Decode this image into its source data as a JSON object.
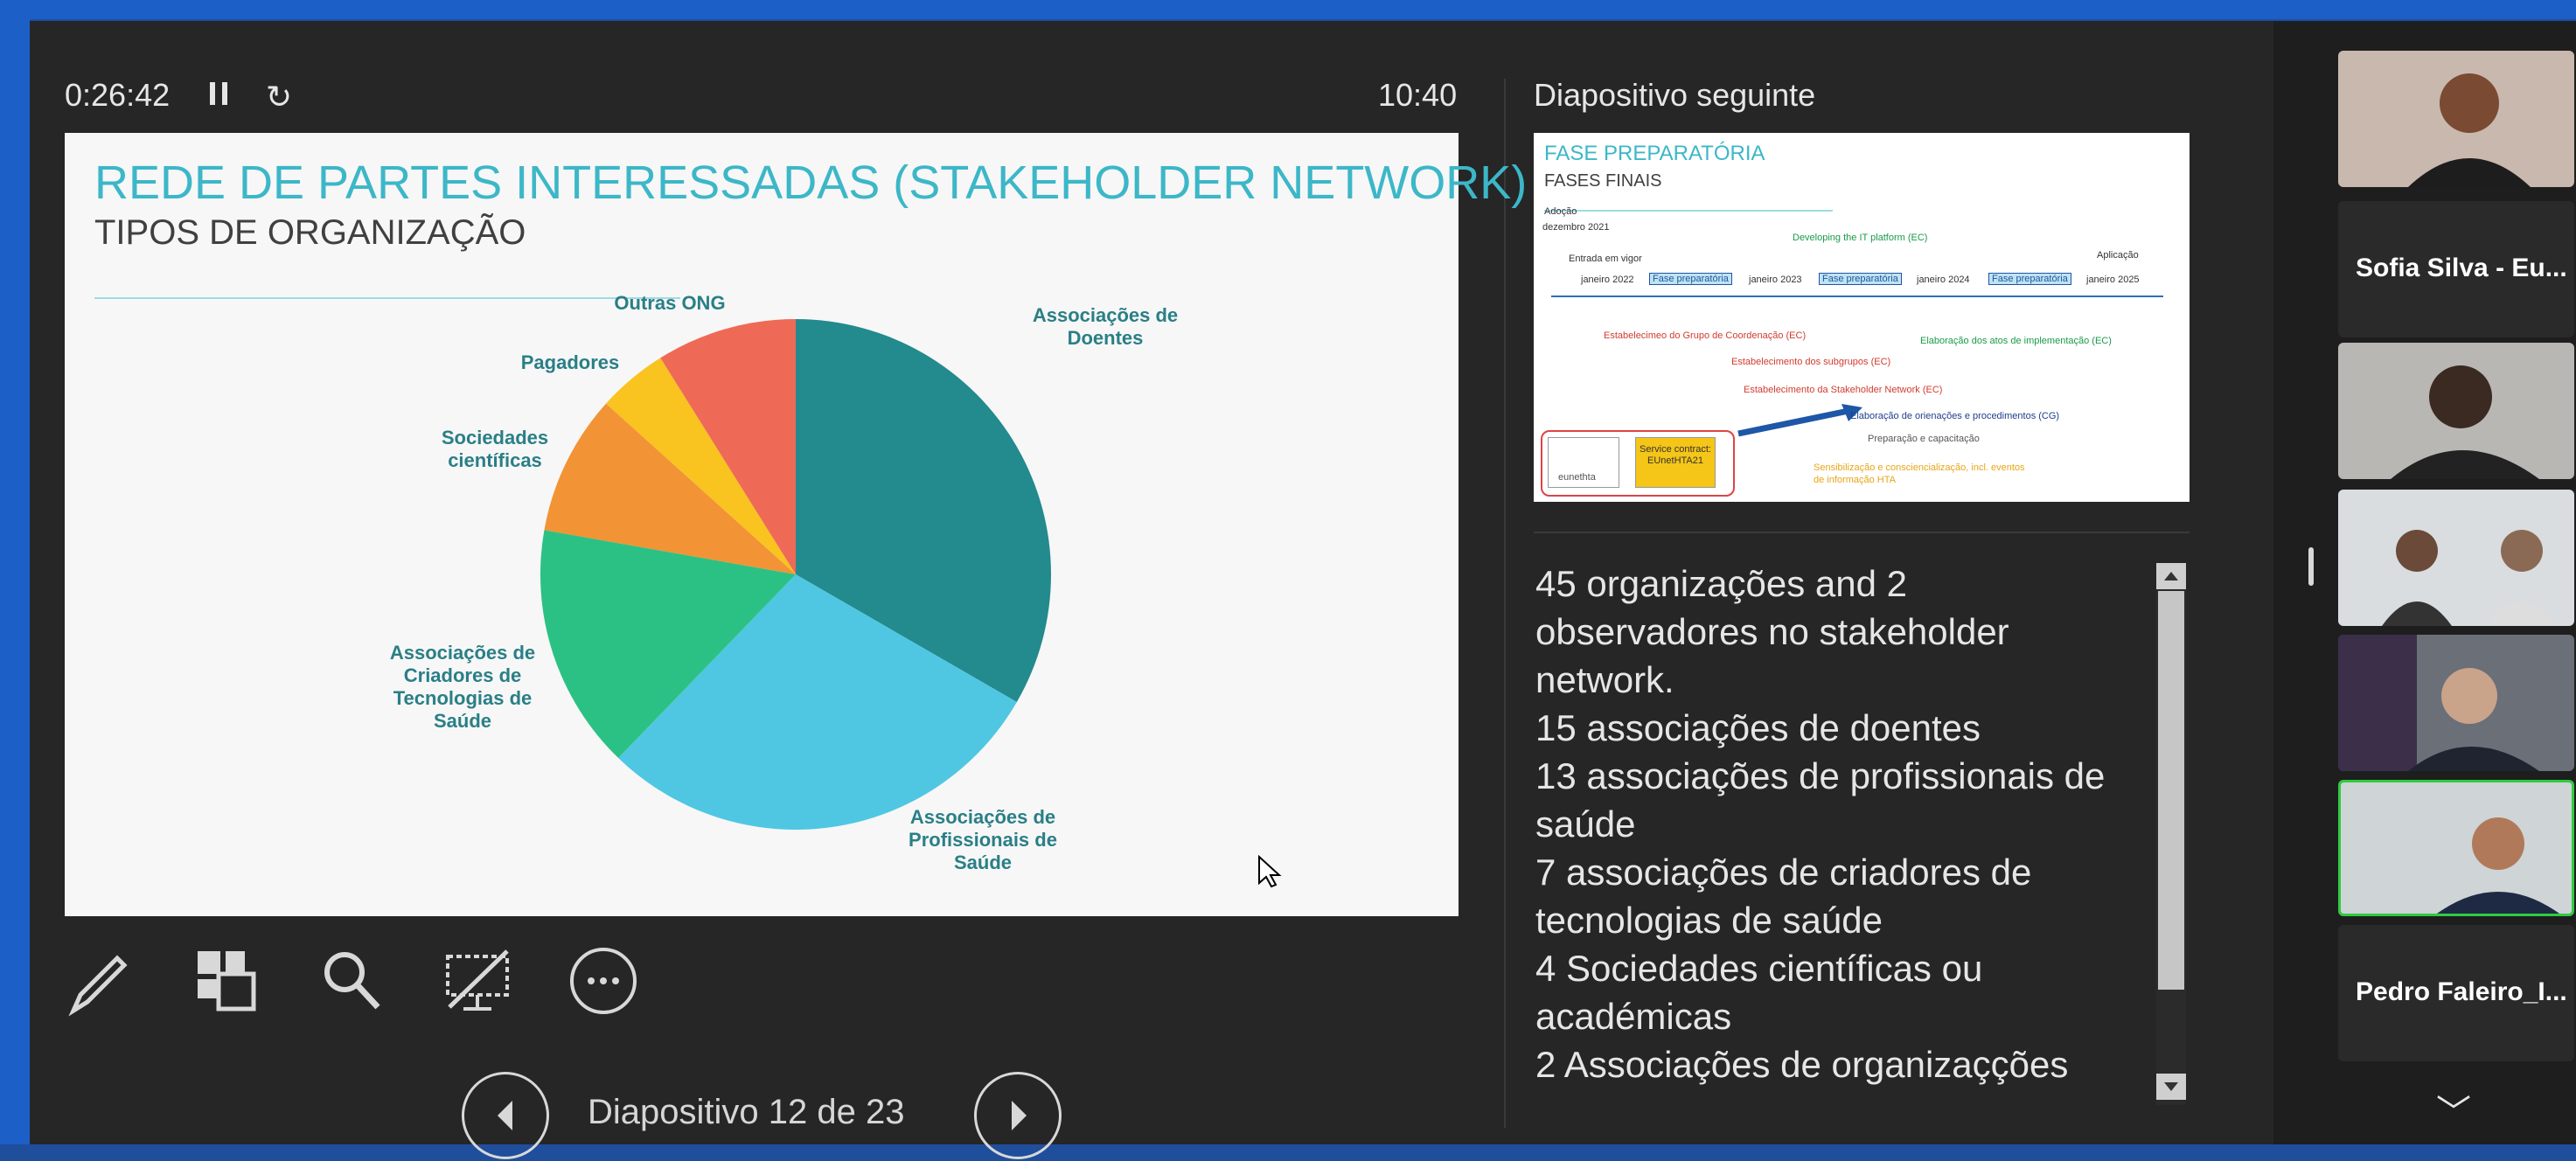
{
  "presenter": {
    "timer": "0:26:42",
    "clock": "10:40",
    "next_slide_title": "Diapositivo seguinte",
    "slide_counter": "Diapositivo 12 de 23"
  },
  "slide": {
    "title": "REDE DE PARTES INTERESSADAS (STAKEHOLDER NETWORK)",
    "subtitle": "TIPOS DE ORGANIZAÇÃO"
  },
  "chart_data": {
    "type": "pie",
    "title": "",
    "categories": [
      "Associações de Doentes",
      "Associações de Profissionais de Saúde",
      "Associações de Criadores de Tecnologias de Saúde",
      "Sociedades científicas",
      "Pagadores",
      "Outras ONG"
    ],
    "values": [
      15,
      13,
      7,
      4,
      2,
      4
    ],
    "colors": [
      "#238a8e",
      "#4fc7e2",
      "#2cc184",
      "#f29335",
      "#f9c320",
      "#ef6a56"
    ],
    "labels": [
      [
        "Associações de",
        "Doentes"
      ],
      [
        "Associações de",
        "Profissionais de",
        "Saúde"
      ],
      [
        "Associações de",
        "Criadores de",
        "Tecnologias de",
        "Saúde"
      ],
      [
        "Sociedades",
        "científicas"
      ],
      [
        "Pagadores"
      ],
      [
        "Outras ONG"
      ]
    ]
  },
  "next_slide": {
    "title": "FASE PREPARATÓRIA",
    "subtitle": "FASES FINAIS",
    "texts": [
      "Adoção",
      "dezembro 2021",
      "Entrada em vigor",
      "janeiro 2022",
      "Fase preparatória",
      "janeiro 2023",
      "Fase preparatória",
      "janeiro 2024",
      "Fase preparatória",
      "janeiro 2025",
      "Aplicação",
      "Developing the IT platform (EC)",
      "Estabelecimeo do Grupo de Coordenação (EC)",
      "Estabelecimento dos subgrupos (EC)",
      "Estabelecimento da Stakeholder Network (EC)",
      "Elaboração dos atos de implementação (EC)",
      "Elaboração de orienações e procedimentos (CG)",
      "Preparação e capacitação",
      "Sensibilização e consciencialização, incl. eventos de informação HTA",
      "eunethta",
      "Service contract: EUnetHTA21"
    ]
  },
  "notes": {
    "lines": [
      "45 organizações and 2",
      "observadores no stakeholder",
      "network.",
      "15 associações de doentes",
      "13 associações de profissionais de",
      "saúde",
      "7 associações de criadores de",
      "tecnologias de saúde",
      "4 Sociedades científicas ou",
      "académicas",
      "2 Associações de organizaçções"
    ]
  },
  "participants": [
    {
      "name": "",
      "bg": "#c9b8ad"
    },
    {
      "name": "Sofia Silva - Eu...",
      "bg": "#2a2a2a"
    },
    {
      "name": "",
      "bg": "#b9b7b4"
    },
    {
      "name": "",
      "bg": "#d9dde0"
    },
    {
      "name": "",
      "bg": "#6a6f78"
    },
    {
      "name": "",
      "bg": "#cfd4d6"
    },
    {
      "name": "Pedro Faleiro_I...",
      "bg": "#2a2a2a"
    }
  ]
}
